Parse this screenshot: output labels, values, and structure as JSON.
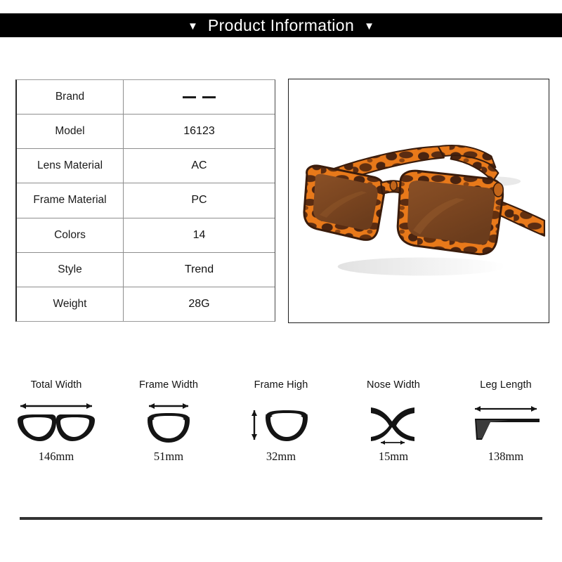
{
  "header": {
    "title": "Product Information",
    "left_marker": "▼",
    "right_marker": "▼"
  },
  "spec_table": {
    "rows": [
      {
        "key": "Brand",
        "value": "— —",
        "is_dash": true
      },
      {
        "key": "Model",
        "value": "16123"
      },
      {
        "key": "Lens Material",
        "value": "AC"
      },
      {
        "key": "Frame Material",
        "value": "PC"
      },
      {
        "key": "Colors",
        "value": "14"
      },
      {
        "key": "Style",
        "value": "Trend"
      },
      {
        "key": "Weight",
        "value": "28G"
      }
    ]
  },
  "product_photo": {
    "alt": "tortoiseshell rectangular sunglasses",
    "frame_light": "#E8791A",
    "frame_mid": "#B5561A",
    "frame_dark": "#4A2410",
    "lens_color": "#7A4520",
    "shadow_color": "#DCDCDC"
  },
  "measurements": [
    {
      "label": "Total Width",
      "value": "146mm",
      "icon": "glasses-front-icon"
    },
    {
      "label": "Frame Width",
      "value": "51mm",
      "icon": "single-lens-width-icon"
    },
    {
      "label": "Frame High",
      "value": "32mm",
      "icon": "single-lens-height-icon"
    },
    {
      "label": "Nose Width",
      "value": "15mm",
      "icon": "nose-bridge-icon"
    },
    {
      "label": "Leg Length",
      "value": "138mm",
      "icon": "temple-arm-icon"
    }
  ],
  "colors": {
    "header_bg": "#000000",
    "header_text": "#ffffff",
    "table_border": "#8e8e8e",
    "rule": "#333333"
  }
}
